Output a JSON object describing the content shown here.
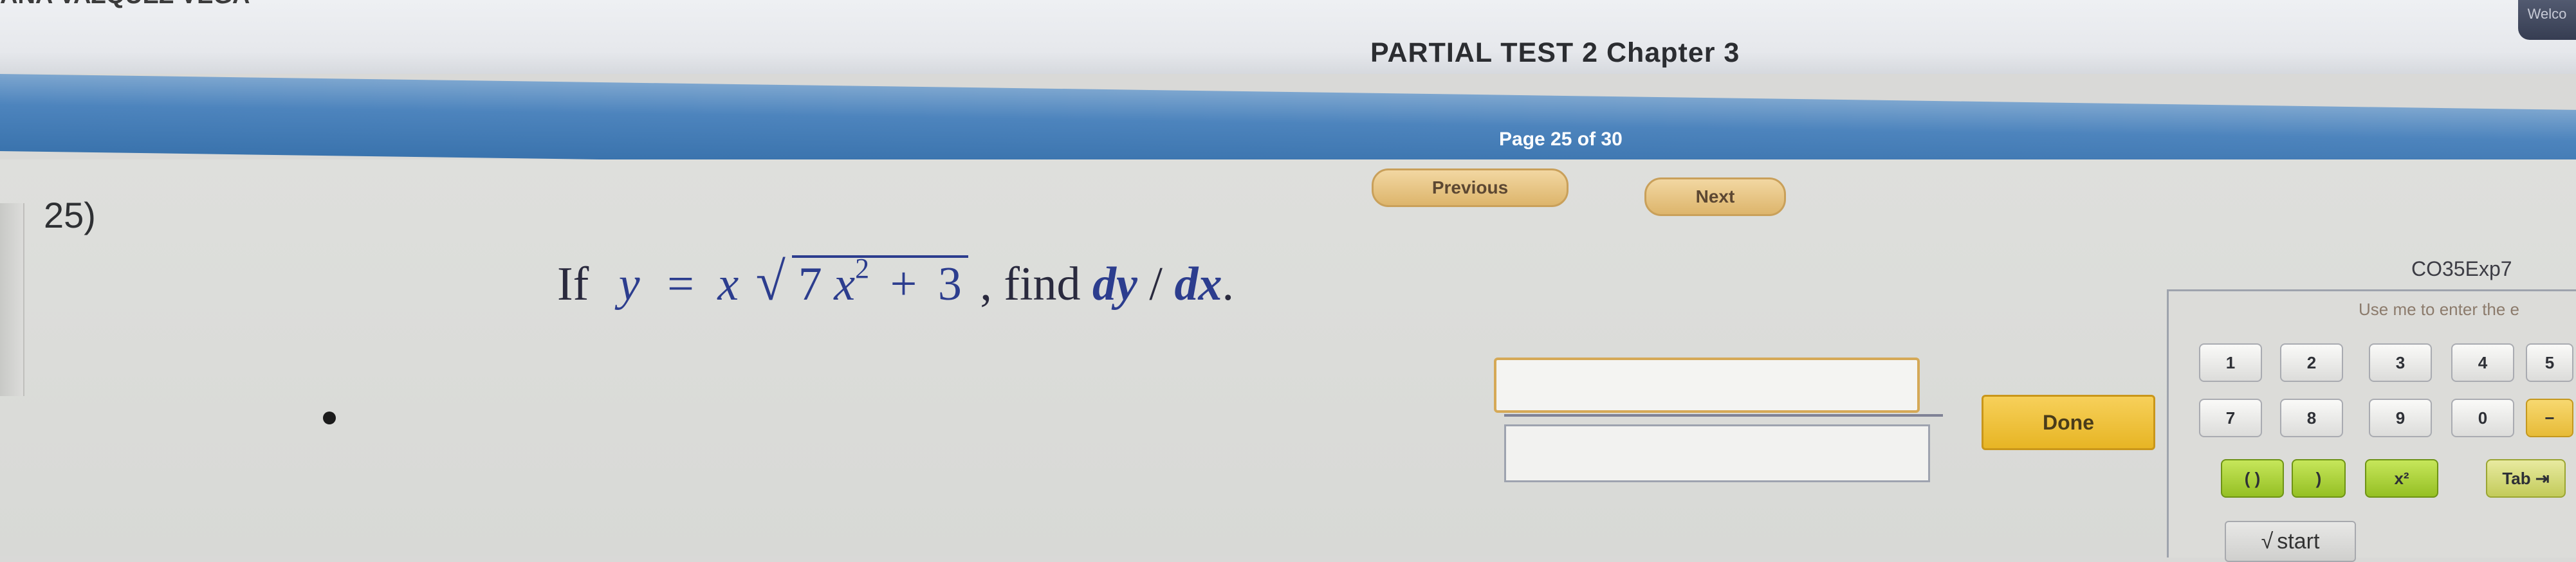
{
  "header": {
    "student_name": "ANA VAZQUEZ VEGA",
    "test_title": "PARTIAL TEST 2 Chapter 3",
    "corner_tab_label": "Welco"
  },
  "navigation": {
    "page_label": "Page 25 of 30",
    "previous_label": "Previous",
    "next_label": "Next"
  },
  "question": {
    "number": "25)",
    "if": "If",
    "y": "y",
    "eq": "=",
    "x": "x",
    "radicand_a": "7",
    "radicand_x": "x",
    "radicand_exp": "2",
    "plus": "+",
    "radicand_b": "3",
    "comma_find": ", find",
    "dy": "dy",
    "slash": "/",
    "dx": "dx",
    "period": "."
  },
  "answer": {
    "numerator_value": "",
    "denominator_value": "",
    "done_label": "Done"
  },
  "keypad": {
    "label": "CO35Exp7",
    "hint": "Use me to enter the e",
    "row1": [
      "1",
      "2",
      "3",
      "4",
      "5"
    ],
    "row2": [
      "7",
      "8",
      "9",
      "0",
      "−"
    ],
    "row3": [
      "( )",
      ")",
      "x²",
      "Tab ⇥"
    ],
    "start_label": "start",
    "start_icon": "√"
  }
}
